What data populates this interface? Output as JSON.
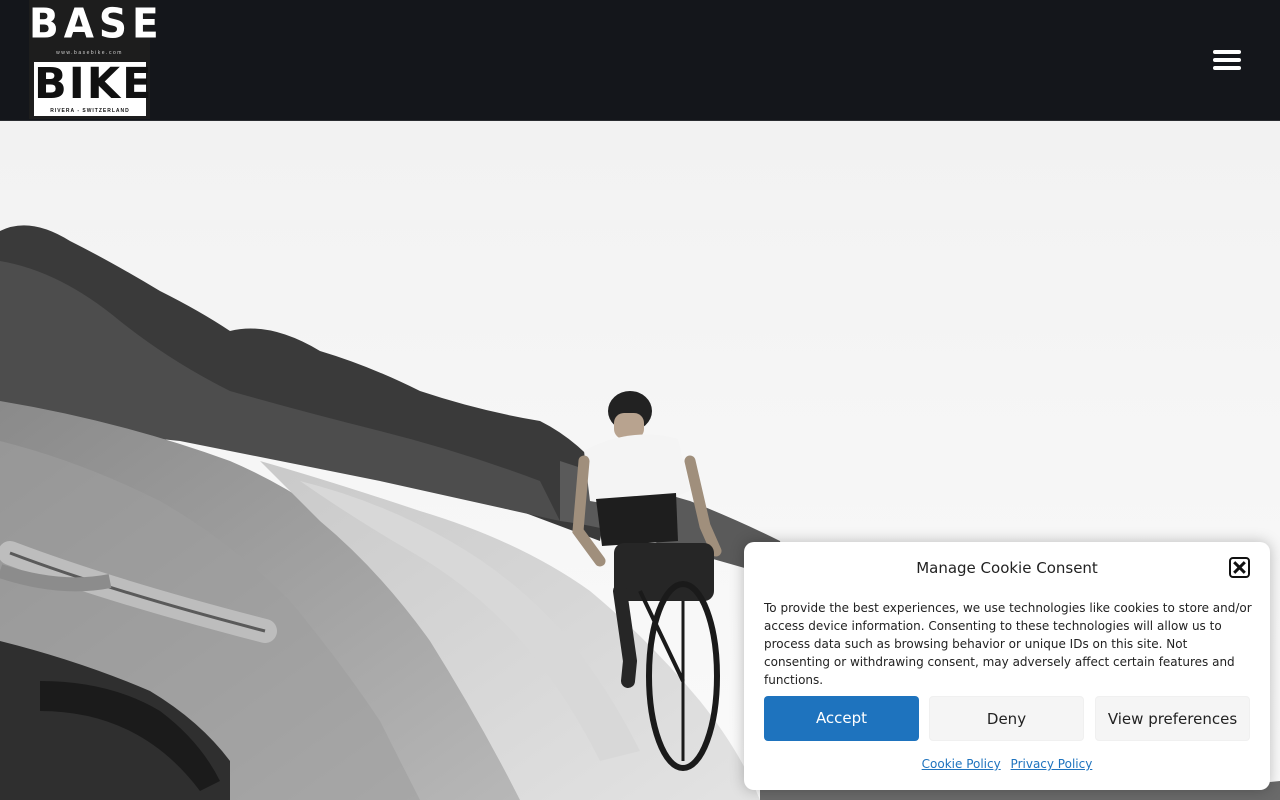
{
  "header": {
    "logo": {
      "top_word": "BASE",
      "url": "www.basebike.com",
      "bottom_word": "BIKE",
      "location": "RIVERA - SWITZERLAND"
    },
    "menu_icon": "hamburger-menu-icon"
  },
  "hero": {
    "image_description_icon": "photo"
  },
  "cookie_banner": {
    "title": "Manage Cookie Consent",
    "close_icon": "close-icon",
    "text": "To provide the best experiences, we use technologies like cookies to store and/or access device information. Consenting to these technologies will allow us to process data such as browsing behavior or unique IDs on this site. Not consenting or withdrawing consent, may adversely affect certain features and functions.",
    "buttons": {
      "accept": "Accept",
      "deny": "Deny",
      "preferences": "View preferences"
    },
    "links": {
      "cookie_policy": "Cookie Policy",
      "privacy_policy": "Privacy Policy"
    },
    "accent_color": "#1e73be"
  }
}
